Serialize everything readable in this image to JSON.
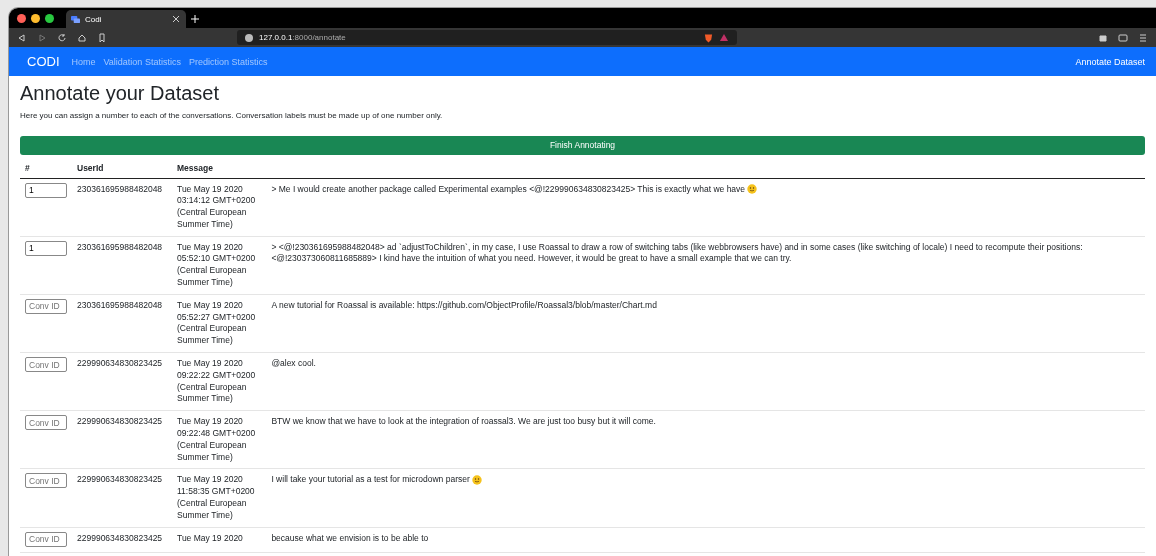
{
  "browser": {
    "tab_title": "Codi",
    "url_host": "127.0.0.1",
    "url_path": ":8000/annotate"
  },
  "navbar": {
    "brand": "CODI",
    "links": [
      {
        "label": "Home"
      },
      {
        "label": "Validation Statistics"
      },
      {
        "label": "Prediction Statistics"
      }
    ],
    "right_link": "Annotate Dataset"
  },
  "heading": "Annotate your Dataset",
  "description": "Here you can assign a number to each of the conversations. Conversation labels must be made up of one number only.",
  "finish_button": "Finish Annotating",
  "table": {
    "columns": [
      "#",
      "UserId",
      "Message"
    ],
    "rows": [
      {
        "value": "1",
        "user_id": "230361695988482048",
        "date": [
          "Tue May 19 2020",
          "03:14:12 GMT+0200",
          "(Central European",
          "Summer Time)"
        ],
        "message": [
          "> Me I would create another package called Experimental examples <@!229990634830823425> This is exactly what we have"
        ],
        "emoji": true
      },
      {
        "value": "1",
        "user_id": "230361695988482048",
        "date": [
          "Tue May 19 2020",
          "05:52:10 GMT+0200",
          "(Central European",
          "Summer Time)"
        ],
        "message": [
          "> <@!230361695988482048> ad `adjustToChildren`, in my case, I use Roassal to draw a row of switching tabs (like webbrowsers have) and in some cases (like switching of locale) I need to recompute their positions:",
          "<@!230373060811685889> I kind have the intuition of what you need. However, it would be great to have a small example that we can try."
        ],
        "emoji": false
      },
      {
        "placeholder": "Conv ID",
        "user_id": "230361695988482048",
        "date": [
          "Tue May 19 2020",
          "05:52:27 GMT+0200",
          "(Central European",
          "Summer Time)"
        ],
        "message": [
          "A new tutorial for Roassal is available: https://github.com/ObjectProfile/Roassal3/blob/master/Chart.md"
        ],
        "emoji": false
      },
      {
        "placeholder": "Conv ID",
        "user_id": "229990634830823425",
        "date": [
          "Tue May 19 2020",
          "09:22:22 GMT+0200",
          "(Central European",
          "Summer Time)"
        ],
        "message": [
          "@alex cool."
        ],
        "emoji": false
      },
      {
        "placeholder": "Conv ID",
        "user_id": "229990634830823425",
        "date": [
          "Tue May 19 2020",
          "09:22:48 GMT+0200",
          "(Central European",
          "Summer Time)"
        ],
        "message": [
          "BTW we know that we have to look at the integration of roassal3. We are just too busy but it will come."
        ],
        "emoji": false
      },
      {
        "placeholder": "Conv ID",
        "user_id": "229990634830823425",
        "date": [
          "Tue May 19 2020",
          "11:58:35 GMT+0200",
          "(Central European",
          "Summer Time)"
        ],
        "message": [
          "I will take your tutorial as a test for microdown parser"
        ],
        "emoji": true
      },
      {
        "placeholder": "Conv ID",
        "user_id": "229990634830823425",
        "date": [
          "Tue May 19 2020"
        ],
        "message": [
          "because what we envision is to be able to"
        ],
        "emoji": false
      }
    ]
  }
}
